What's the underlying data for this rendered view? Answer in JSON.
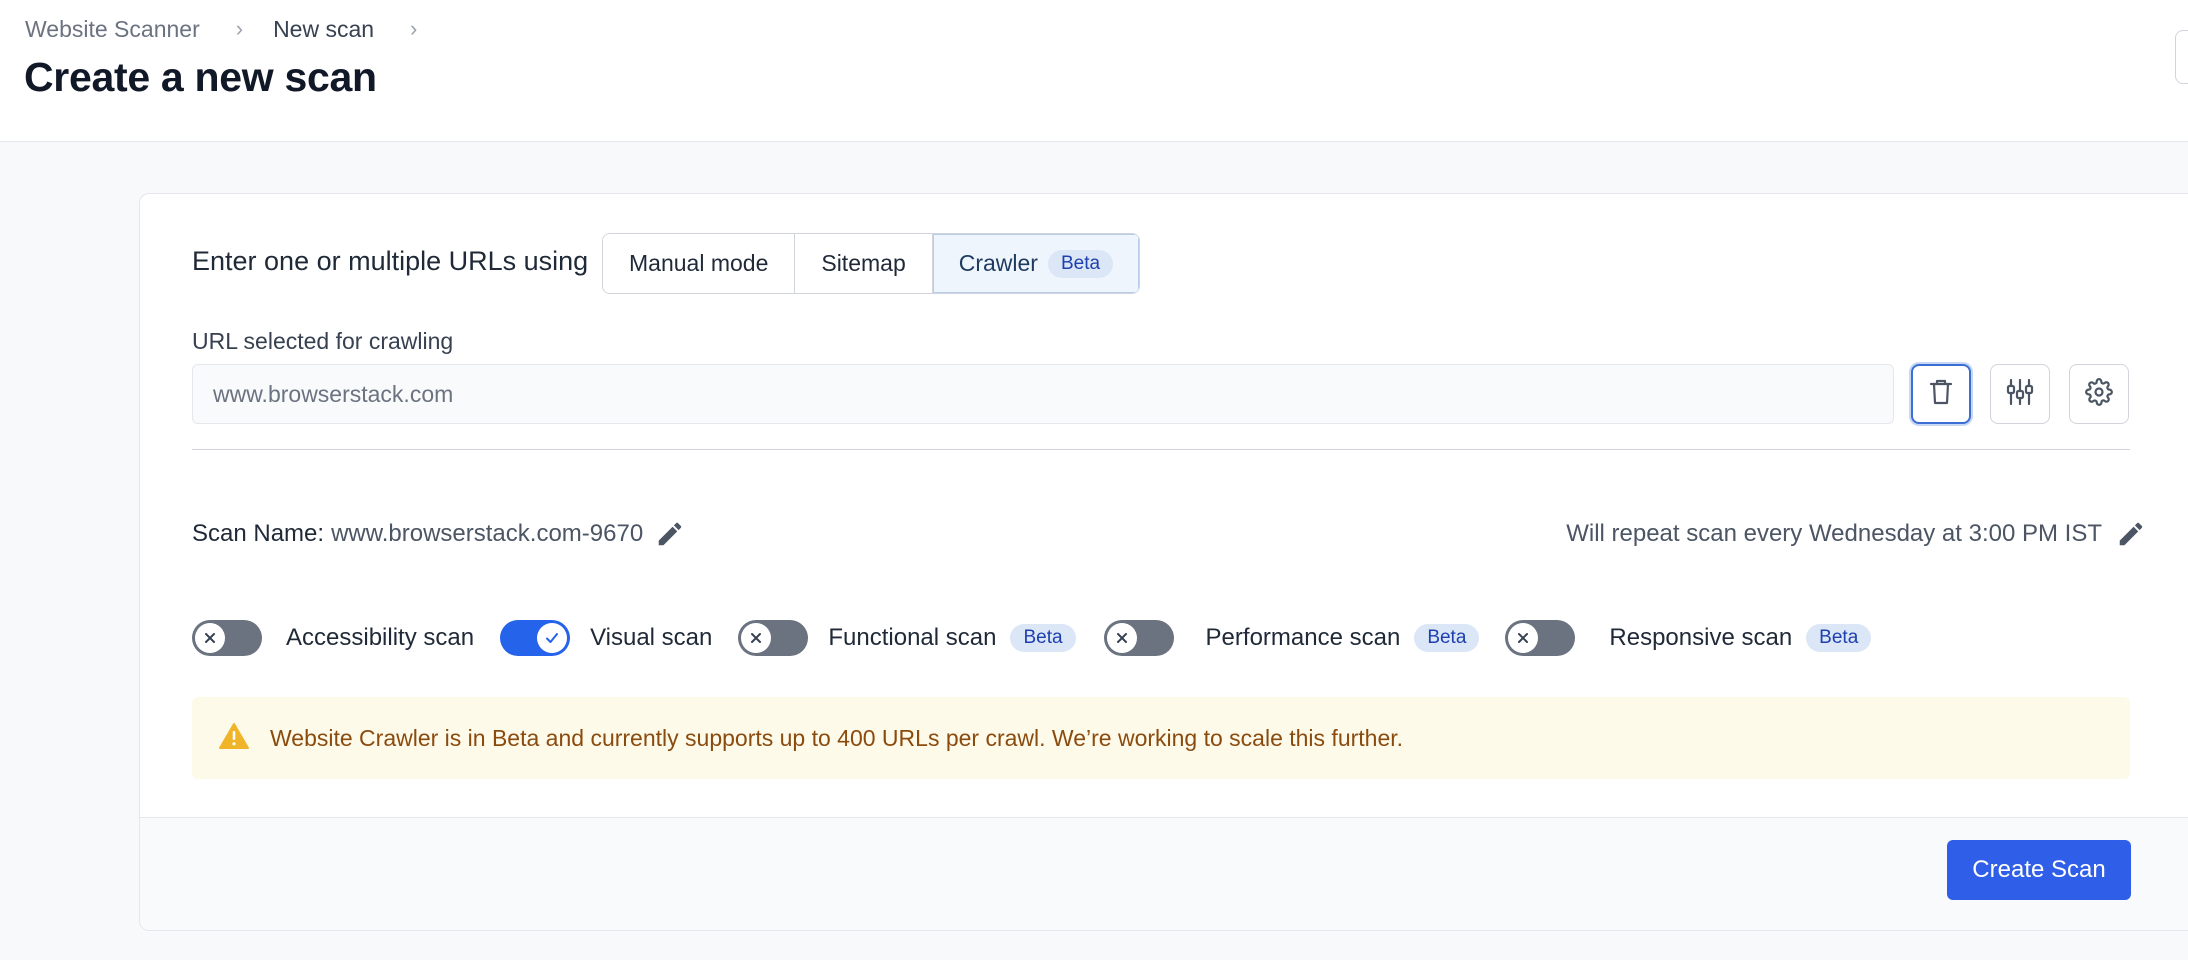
{
  "breadcrumb": {
    "items": [
      "Website Scanner",
      "New scan"
    ]
  },
  "page": {
    "title": "Create a new scan"
  },
  "mode": {
    "label": "Enter one or multiple URLs using",
    "options": [
      {
        "label": "Manual mode"
      },
      {
        "label": "Sitemap"
      },
      {
        "label": "Crawler",
        "badge": "Beta",
        "selected": true
      }
    ]
  },
  "url": {
    "label": "URL selected for crawling",
    "placeholder": "www.browserstack.com"
  },
  "icons": {
    "delete": "trash-icon",
    "filters": "sliders-icon",
    "settings": "gear-icon",
    "edit": "pencil-icon",
    "warning": "warning-triangle-icon"
  },
  "scan": {
    "name_label": "Scan Name:",
    "name_value": "www.browserstack.com-9670",
    "schedule": "Will repeat scan every Wednesday at 3:00 PM IST"
  },
  "toggles": [
    {
      "label": "Accessibility scan",
      "on": false
    },
    {
      "label": "Visual scan",
      "on": true
    },
    {
      "label": "Functional scan",
      "on": false,
      "badge": "Beta"
    },
    {
      "label": "Performance scan",
      "on": false,
      "badge": "Beta"
    },
    {
      "label": "Responsive scan",
      "on": false,
      "badge": "Beta"
    }
  ],
  "notice": {
    "text": "Website Crawler is in Beta and currently supports up to 400 URLs per crawl. We’re working to scale this further."
  },
  "footer": {
    "create_button": "Create Scan"
  },
  "colors": {
    "primary": "#2f5ee8",
    "toggle_on": "#2563eb",
    "toggle_off": "#6b7280",
    "warning_bg": "#fefaea",
    "warning_text": "#8a4b0f",
    "warning_icon": "#f0b429"
  }
}
